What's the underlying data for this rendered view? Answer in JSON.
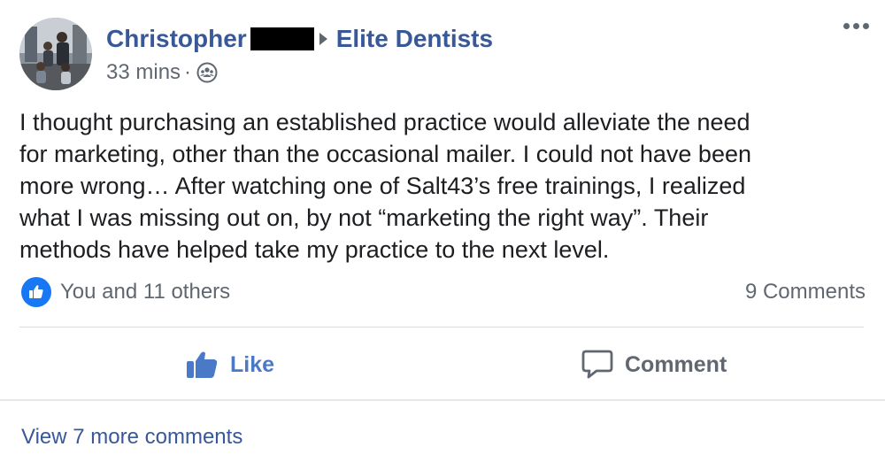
{
  "post": {
    "author": "Christopher",
    "group": "Elite Dentists",
    "time": "33 mins",
    "separator": "·",
    "privacy_icon": "group-privacy-icon",
    "text": "I thought purchasing an established practice would alleviate the need\nfor marketing, other than the occasional mailer. I could not have been\nmore wrong… After watching one of Salt43’s free trainings, I realized\nwhat I was missing out on, by not “marketing the right way”. Their\nmethods have helped take my practice to the next level."
  },
  "reactions": {
    "summary": "You and 11 others",
    "comments": "9 Comments"
  },
  "actions": {
    "like": "Like",
    "comment": "Comment"
  },
  "footer": {
    "view_more": "View 7 more comments"
  },
  "colors": {
    "link_blue": "#385898",
    "like_blue": "#4a79c7",
    "badge_blue": "#1877f2",
    "muted": "#606770"
  }
}
